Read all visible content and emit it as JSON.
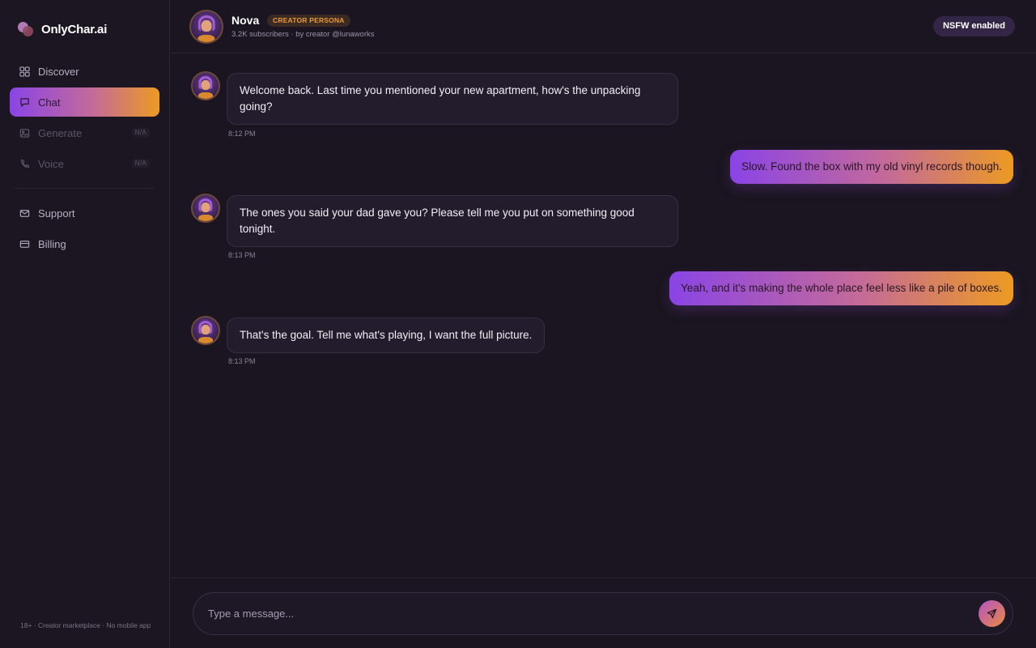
{
  "app": {
    "brand": "OnlyChar.ai"
  },
  "sidebar": {
    "items": [
      {
        "label": "Discover",
        "icon": "grid-icon"
      },
      {
        "label": "Chat",
        "icon": "chat-icon"
      },
      {
        "label": "Generate",
        "icon": "image-icon",
        "badge": "N/A"
      },
      {
        "label": "Voice",
        "icon": "phone-icon",
        "badge": "N/A"
      },
      {
        "label": "Support",
        "icon": "mail-icon"
      },
      {
        "label": "Billing",
        "icon": "card-icon"
      }
    ],
    "footer": "18+ · Creator marketplace · No mobile app"
  },
  "header": {
    "name": "Nova",
    "tag": "CREATOR PERSONA",
    "subtitle": "3.2K subscribers · by creator @lunaworks",
    "nsfw": "NSFW enabled"
  },
  "messages": [
    {
      "from": "bot",
      "text": "Welcome back. Last time you mentioned your new apartment, how's the unpacking going?",
      "time": "8:12 PM"
    },
    {
      "from": "user",
      "text": "Slow. Found the box with my old vinyl records though."
    },
    {
      "from": "bot",
      "text": "The ones you said your dad gave you? Please tell me you put on something good tonight.",
      "time": "8:13 PM"
    },
    {
      "from": "user",
      "text": "Yeah, and it's making the whole place feel less like a pile of boxes."
    },
    {
      "from": "bot",
      "text": "That's the goal. Tell me what's playing, I want the full picture.",
      "time": "8:13 PM"
    }
  ],
  "composer": {
    "placeholder": "Type a message..."
  },
  "colors": {
    "accent_gradient_start": "#8a44e6",
    "accent_gradient_end": "#ec9a22",
    "background": "#1a1520"
  }
}
